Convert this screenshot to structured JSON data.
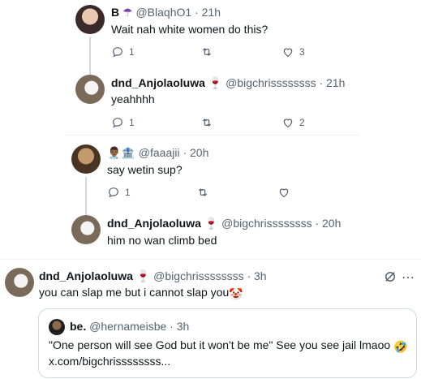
{
  "tweets": [
    {
      "name": "B",
      "handle": "@BlaqhO1",
      "time": "21h",
      "text": "Wait nah white women do this?",
      "replies": "1",
      "retweets": "",
      "likes": "3"
    },
    {
      "name": "dnd_Anjolaoluwa",
      "handle": "@bigchrissssssss",
      "time": "21h",
      "text": "yeahhhh",
      "replies": "1",
      "retweets": "",
      "likes": "2"
    },
    {
      "name": "",
      "handle": "@faaajii",
      "time": "20h",
      "text": "say wetin sup?",
      "replies": "1",
      "retweets": "",
      "likes": ""
    },
    {
      "name": "dnd_Anjolaoluwa",
      "handle": "@bigchrissssssss",
      "time": "20h",
      "text": "him no wan climb bed"
    },
    {
      "name": "dnd_Anjolaoluwa",
      "handle": "@bigchrissssssss",
      "time": "3h",
      "text": "you can slap me but i cannot slap you"
    }
  ],
  "quote": {
    "name": "be.",
    "handle": "@hernameisbe",
    "time": "3h",
    "text": "\"One person will see God but it won't be me\" See you see jail lmaoo",
    "link": "x.com/bigchrissssssss..."
  },
  "separator": "·",
  "icons": {
    "reply": "reply-icon",
    "retweet": "retweet-icon",
    "like": "heart-icon",
    "wine": "wine-glass-icon",
    "umbrella": "umbrella-icon",
    "grok": "grok-icon",
    "more": "more-icon",
    "clown": "clown-face-icon",
    "laugh": "rolling-laughing-icon"
  },
  "colors": {
    "text": "#0f1419",
    "muted": "#536471",
    "border": "#cfd9de",
    "wine": "#c0392b"
  }
}
